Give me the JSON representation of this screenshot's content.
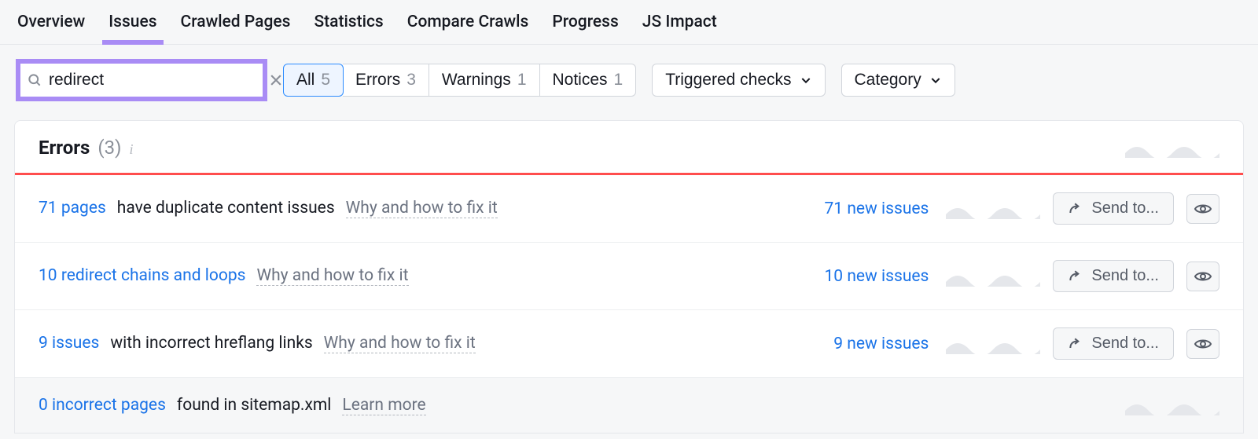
{
  "tabs": {
    "items": [
      {
        "label": "Overview"
      },
      {
        "label": "Issues",
        "active": true
      },
      {
        "label": "Crawled Pages"
      },
      {
        "label": "Statistics"
      },
      {
        "label": "Compare Crawls"
      },
      {
        "label": "Progress"
      },
      {
        "label": "JS Impact"
      }
    ]
  },
  "search": {
    "value": "redirect"
  },
  "severity_filters": {
    "all": {
      "label": "All",
      "count": "5",
      "active": true
    },
    "errors": {
      "label": "Errors",
      "count": "3"
    },
    "warnings": {
      "label": "Warnings",
      "count": "1"
    },
    "notices": {
      "label": "Notices",
      "count": "1"
    }
  },
  "dropdowns": {
    "triggered": {
      "label": "Triggered checks"
    },
    "category": {
      "label": "Category"
    }
  },
  "panel": {
    "title": "Errors",
    "count_display": "(3)"
  },
  "rows": [
    {
      "link_text": "71 pages",
      "desc_text": "have duplicate content issues",
      "hint_text": "Why and how to fix it",
      "new_issues_text": "71 new issues"
    },
    {
      "link_text": "10 redirect chains and loops",
      "desc_text": "",
      "hint_text": "Why and how to fix it",
      "new_issues_text": "10 new issues"
    },
    {
      "link_text": "9 issues",
      "desc_text": "with incorrect hreflang links",
      "hint_text": "Why and how to fix it",
      "new_issues_text": "9 new issues"
    },
    {
      "link_text": "0 incorrect pages",
      "desc_text": "found in sitemap.xml",
      "hint_text": "Learn more",
      "new_issues_text": "",
      "muted": true
    }
  ],
  "buttons": {
    "send_to_label": "Send to..."
  }
}
